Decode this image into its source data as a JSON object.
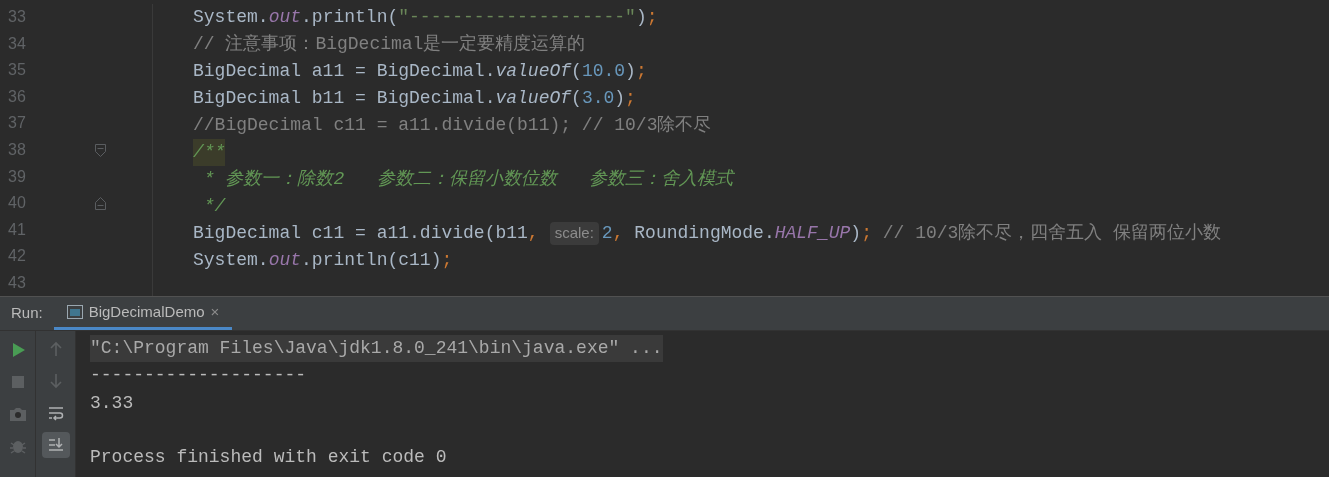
{
  "editor": {
    "lines": [
      {
        "number": "33",
        "tokens": [
          {
            "kind": "plain",
            "text": "System."
          },
          {
            "kind": "field",
            "text": "out"
          },
          {
            "kind": "plain",
            "text": ".println("
          },
          {
            "kind": "string",
            "text": "\"--------------------\""
          },
          {
            "kind": "plain",
            "text": ")"
          },
          {
            "kind": "punct",
            "text": ";"
          }
        ]
      },
      {
        "number": "34",
        "tokens": [
          {
            "kind": "comment",
            "text": "// 注意事项：BigDecimal是一定要精度运算的"
          }
        ]
      },
      {
        "number": "35",
        "tokens": [
          {
            "kind": "plain",
            "text": "BigDecimal a11 = BigDecimal."
          },
          {
            "kind": "static",
            "text": "valueOf"
          },
          {
            "kind": "plain",
            "text": "("
          },
          {
            "kind": "number",
            "text": "10.0"
          },
          {
            "kind": "plain",
            "text": ")"
          },
          {
            "kind": "punct",
            "text": ";"
          }
        ]
      },
      {
        "number": "36",
        "tokens": [
          {
            "kind": "plain",
            "text": "BigDecimal b11 = BigDecimal."
          },
          {
            "kind": "static",
            "text": "valueOf"
          },
          {
            "kind": "plain",
            "text": "("
          },
          {
            "kind": "number",
            "text": "3.0"
          },
          {
            "kind": "plain",
            "text": ")"
          },
          {
            "kind": "punct",
            "text": ";"
          }
        ]
      },
      {
        "number": "37",
        "tokens": [
          {
            "kind": "comment",
            "text": "//BigDecimal c11 = a11.divide(b11); // 10/3除不尽"
          }
        ]
      },
      {
        "number": "38",
        "fold_start": true,
        "tokens": [
          {
            "kind": "doc-highlight",
            "text": "/**"
          }
        ]
      },
      {
        "number": "39",
        "tokens": [
          {
            "kind": "doc",
            "text": " * 参数一：除数2   参数二：保留小数位数   参数三：舍入模式"
          }
        ]
      },
      {
        "number": "40",
        "fold_end": true,
        "tokens": [
          {
            "kind": "doc",
            "text": " */"
          }
        ]
      },
      {
        "number": "41",
        "tokens": [
          {
            "kind": "plain",
            "text": "BigDecimal c11 = a11.divide(b11"
          },
          {
            "kind": "punct",
            "text": ","
          },
          {
            "kind": "hint",
            "text": "scale:"
          },
          {
            "kind": "number",
            "text": "2"
          },
          {
            "kind": "punct",
            "text": ","
          },
          {
            "kind": "plain",
            "text": " RoundingMode."
          },
          {
            "kind": "field",
            "text": "HALF_UP"
          },
          {
            "kind": "plain",
            "text": ")"
          },
          {
            "kind": "punct",
            "text": ";"
          },
          {
            "kind": "comment",
            "text": " // 10/3除不尽，四舍五入 保留两位小数"
          }
        ]
      },
      {
        "number": "42",
        "tokens": [
          {
            "kind": "plain",
            "text": "System."
          },
          {
            "kind": "field",
            "text": "out"
          },
          {
            "kind": "plain",
            "text": ".println(c11)"
          },
          {
            "kind": "punct",
            "text": ";"
          }
        ]
      },
      {
        "number": "43"
      }
    ]
  },
  "run_panel": {
    "label": "Run:",
    "tabs": [
      {
        "label": "BigDecimalDemo",
        "selected": true,
        "close": "×"
      }
    ],
    "tools_left": [
      {
        "kind": "run"
      },
      {
        "kind": "stop"
      },
      {
        "kind": "camera"
      },
      {
        "kind": "bug"
      }
    ],
    "tools_right": [
      {
        "kind": "up",
        "selected": false
      },
      {
        "kind": "down",
        "selected": false
      },
      {
        "kind": "wrap",
        "selected": false
      },
      {
        "kind": "scroll-end",
        "selected": true
      }
    ],
    "console": [
      {
        "kind": "command",
        "text": "\"C:\\Program Files\\Java\\jdk1.8.0_241\\bin\\java.exe\" ..."
      },
      {
        "kind": "output",
        "text": "--------------------"
      },
      {
        "kind": "output",
        "text": "3.33"
      },
      {
        "kind": "blank"
      },
      {
        "kind": "output",
        "text": "Process finished with exit code 0"
      }
    ]
  }
}
